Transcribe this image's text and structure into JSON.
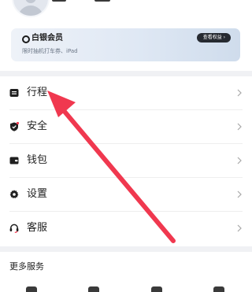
{
  "vip": {
    "title": "白银会员",
    "subtitle": "限时抽机打车券、iPad",
    "button_label": "查看权益 ›"
  },
  "menu": [
    {
      "label": "行程",
      "icon": "itinerary-icon"
    },
    {
      "label": "安全",
      "icon": "shield-icon"
    },
    {
      "label": "钱包",
      "icon": "wallet-icon"
    },
    {
      "label": "设置",
      "icon": "settings-gear-icon"
    },
    {
      "label": "客服",
      "icon": "headset-icon"
    }
  ],
  "more_services": {
    "title": "更多服务"
  },
  "annotation": {
    "color": "#f0384f"
  }
}
